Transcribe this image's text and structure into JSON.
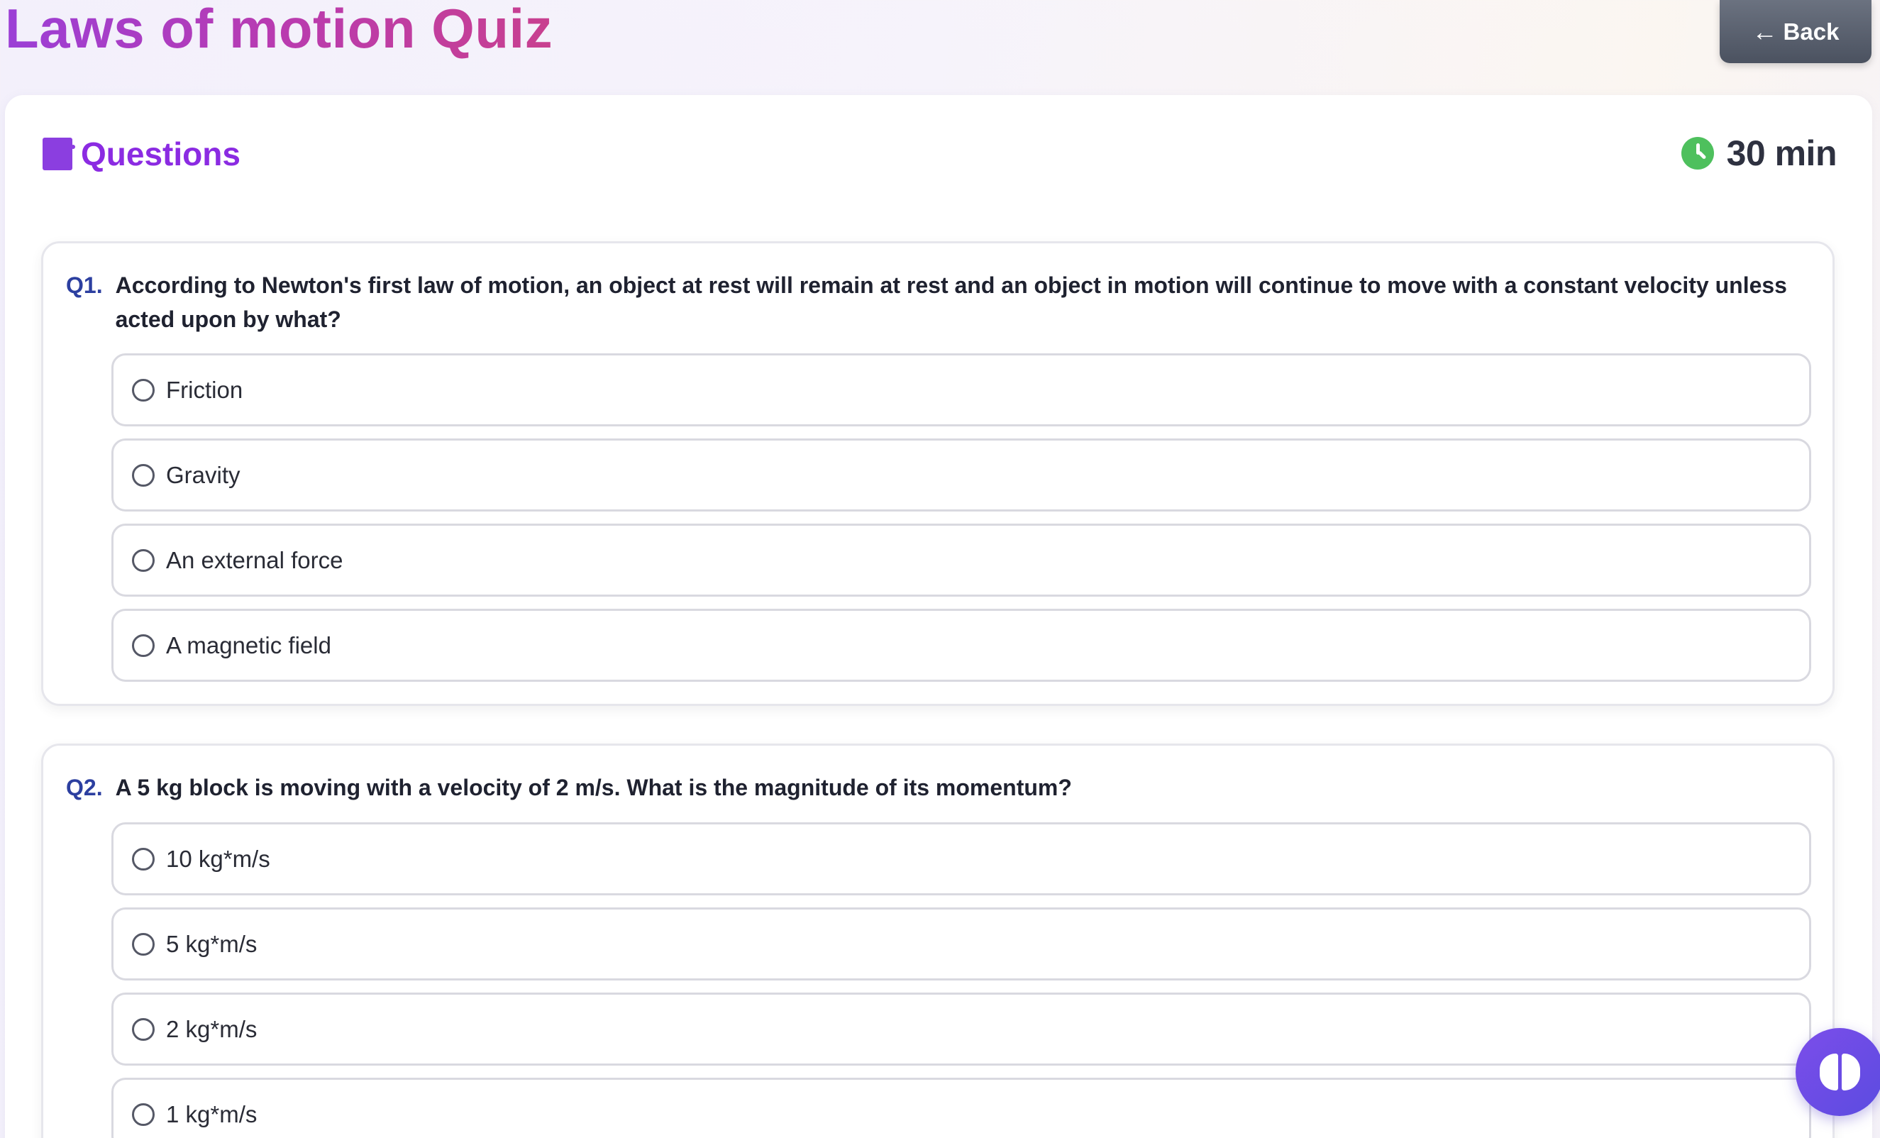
{
  "header": {
    "title": "Laws of motion Quiz",
    "back_label": "Back",
    "back_icon": "←"
  },
  "quiz": {
    "section_title": "Questions",
    "timer": "30 min",
    "questions": [
      {
        "number": "Q1.",
        "text": "According to Newton's first law of motion, an object at rest will remain at rest and an object in motion will continue to move with a constant velocity unless acted upon by what?",
        "options": [
          "Friction",
          "Gravity",
          "An external force",
          "A magnetic field"
        ]
      },
      {
        "number": "Q2.",
        "text": "A 5 kg block is moving with a velocity of 2 m/s. What is the magnitude of its momentum?",
        "options": [
          "10 kg*m/s",
          "5 kg*m/s",
          "2 kg*m/s",
          "1 kg*m/s"
        ]
      }
    ]
  },
  "icons": {
    "section": "book-icon",
    "timer": "clock-icon",
    "fab": "brain-icon"
  },
  "colors": {
    "accent": "#8b2be2",
    "title_gradient_start": "#9b3fd6",
    "title_gradient_end": "#c8408f",
    "question_number": "#2c3fa0",
    "timer_icon": "#4ec05d",
    "back_button": "#5b6170",
    "fab": "#6a4be6"
  }
}
